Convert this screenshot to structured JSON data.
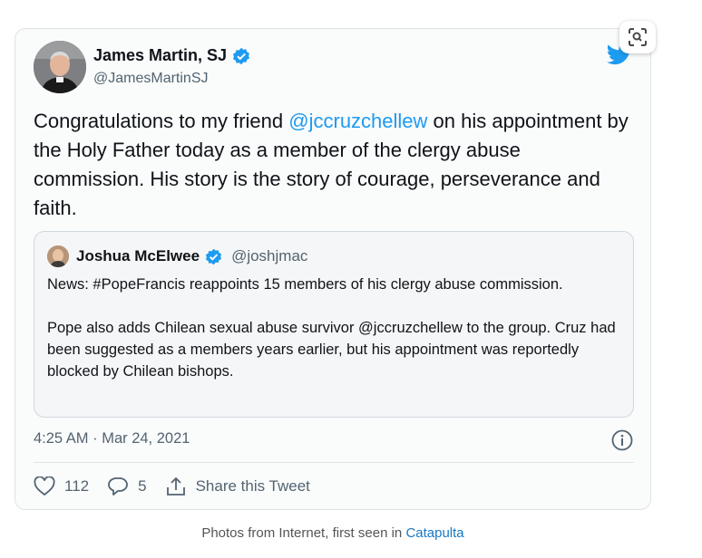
{
  "tweet": {
    "author": {
      "name": "James Martin, SJ",
      "handle": "@JamesMartinSJ"
    },
    "text": {
      "before": "Congratulations to my friend ",
      "mention": "@jccruzchellew",
      "after": " on his appointment by the Holy Father today as a member of the clergy abuse commission. His story is the story of courage, perseverance and faith."
    },
    "quoted": {
      "name": "Joshua McElwee",
      "handle": "@joshjmac",
      "paragraph1": "News: #PopeFrancis reappoints 15 members of his clergy abuse commission.",
      "paragraph2": "Pope also adds Chilean sexual abuse survivor @jccruzchellew to the group. Cruz had been suggested as a members years earlier, but his appointment was reportedly blocked by Chilean bishops."
    },
    "timestamp": "4:25 AM · Mar 24, 2021",
    "actions": {
      "likes": "112",
      "replies": "5",
      "share_label": "Share this Tweet"
    }
  },
  "caption": {
    "text": "Photos from Internet, first seen in ",
    "link": "Catapulta"
  },
  "colors": {
    "accent": "#1d9bf0",
    "verified": "#1d9bf0",
    "text": "#0f1419",
    "muted": "#536471"
  },
  "icons": [
    "lens-icon",
    "twitter-logo-icon",
    "verified-badge-icon",
    "info-icon",
    "heart-icon",
    "reply-icon",
    "share-icon"
  ]
}
